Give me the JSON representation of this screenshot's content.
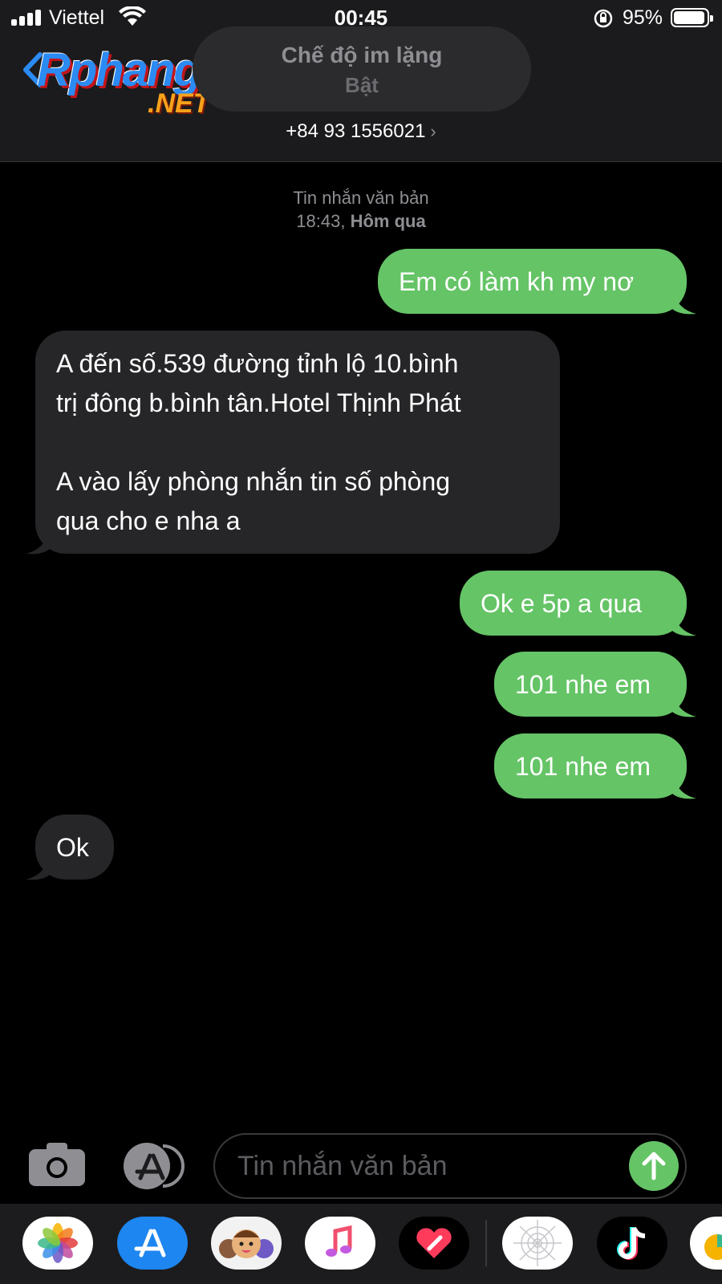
{
  "status": {
    "carrier": "Viettel",
    "time": "00:45",
    "battery": "95%",
    "battery_level": 0.95
  },
  "header": {
    "logo_main": "Rphang$",
    "logo_sub": ".NET",
    "silent_title": "Chế độ im lặng",
    "silent_state": "Bật",
    "contact": "+84 93 1556021"
  },
  "thread": {
    "timestamp_label": "Tin nhắn văn bản",
    "timestamp_time": "18:43,",
    "timestamp_day": "Hôm qua",
    "messages": [
      {
        "dir": "sent",
        "text": "Em có làm kh my nơ"
      },
      {
        "dir": "received",
        "lines": [
          "A đến số.539 đường tỉnh lộ 10.bình",
          "trị đông b.bình tân.Hotel Thịnh Phát",
          "",
          "A vào lấy phòng nhắn tin số phòng",
          "qua cho e nha a"
        ]
      },
      {
        "dir": "sent",
        "text": "Ok e 5p a qua"
      },
      {
        "dir": "sent",
        "text": "101 nhe em"
      },
      {
        "dir": "sent",
        "text": "101 nhe em"
      },
      {
        "dir": "received",
        "text": "Ok"
      }
    ]
  },
  "composer": {
    "placeholder": "Tin nhắn văn bản"
  },
  "drawer": {
    "apps": [
      "photos-icon",
      "app-store-icon",
      "memoji-icon",
      "music-icon",
      "digital-touch-icon",
      "game-app-icon",
      "tiktok-icon",
      "partial-app-icon"
    ]
  },
  "colors": {
    "sent_bubble": "#65c466",
    "received_bubble": "#262628",
    "header_bg": "#1b1b1d"
  }
}
